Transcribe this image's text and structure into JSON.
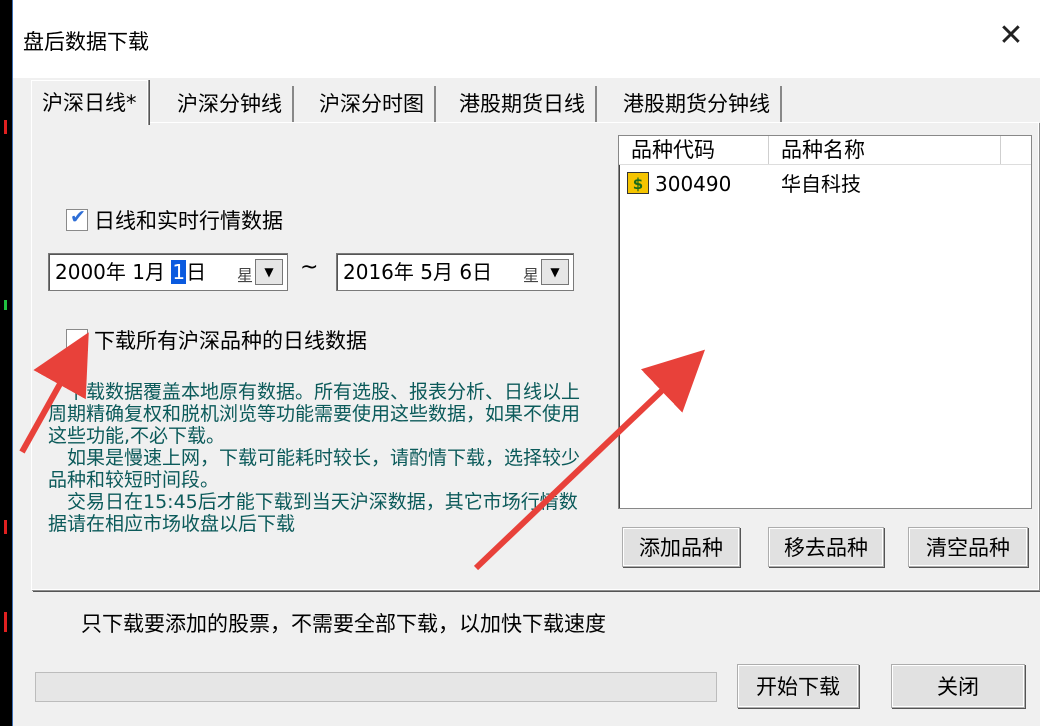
{
  "window": {
    "title": "盘后数据下载",
    "close_symbol": "✕"
  },
  "tabs": [
    {
      "label": "沪深日线*",
      "active": true
    },
    {
      "label": "沪深分钟线",
      "active": false
    },
    {
      "label": "沪深分时图",
      "active": false
    },
    {
      "label": "港股期货日线",
      "active": false
    },
    {
      "label": "港股期货分钟线",
      "active": false
    }
  ],
  "daily": {
    "realtime_checkbox": {
      "label": "日线和实时行情数据",
      "checked": true
    },
    "start_date": {
      "year": "2000年",
      "month": "1月",
      "day_pre": "",
      "day_sel": "1",
      "day_post": "日",
      "spin": "星"
    },
    "range_separator": "~",
    "end_date": {
      "year": "2016年",
      "month": "5月",
      "day_pre": "6",
      "day_sel": "",
      "day_post": "日",
      "spin": "星"
    },
    "all_symbols_checkbox": {
      "label": "下载所有沪深品种的日线数据",
      "checked": false
    },
    "info": [
      "　下载数据覆盖本地原有数据。所有选股、报表分析、日线以上周期精确复权和脱机浏览等功能需要使用这些数据，如果不使用这些功能,不必下载。",
      "　如果是慢速上网，下载可能耗时较长，请酌情下载，选择较少品种和较短时间段。",
      "　交易日在15:45后才能下载到当天沪深数据，其它市场行情数据请在相应市场收盘以后下载"
    ]
  },
  "symbol_list": {
    "columns": [
      "品种代码",
      "品种名称"
    ],
    "rows": [
      {
        "icon": "dollar-icon",
        "code": "300490",
        "name": "华自科技"
      }
    ]
  },
  "buttons": {
    "add": "添加品种",
    "remove": "移去品种",
    "clear": "清空品种",
    "start": "开始下载",
    "close": "关闭"
  },
  "note": "只下载要添加的股票，不需要全部下载，以加快下载速度",
  "progress": {
    "percent": 0
  },
  "colors": {
    "annotation_arrow": "#e8413a",
    "info_text": "#0b5a5a",
    "accent": "#0a5adf"
  }
}
